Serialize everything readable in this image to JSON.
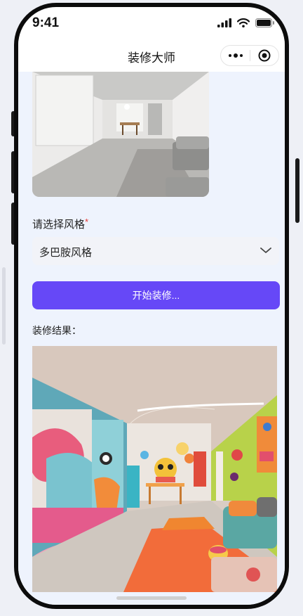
{
  "status_bar": {
    "time": "9:41",
    "icons": [
      "signal-icon",
      "wifi-icon",
      "battery-icon"
    ]
  },
  "nav": {
    "title": "装修大师",
    "more_icon": "more-dots-icon",
    "close_icon": "target-close-icon"
  },
  "form": {
    "style_label": "请选择风格",
    "required_mark": "*",
    "style_selected": "多巴胺风格",
    "submit_label": "开始装修...",
    "result_label": "装修结果："
  },
  "colors": {
    "accent": "#6648f7",
    "content_bg": "#eef3fd",
    "required": "#e53935"
  }
}
